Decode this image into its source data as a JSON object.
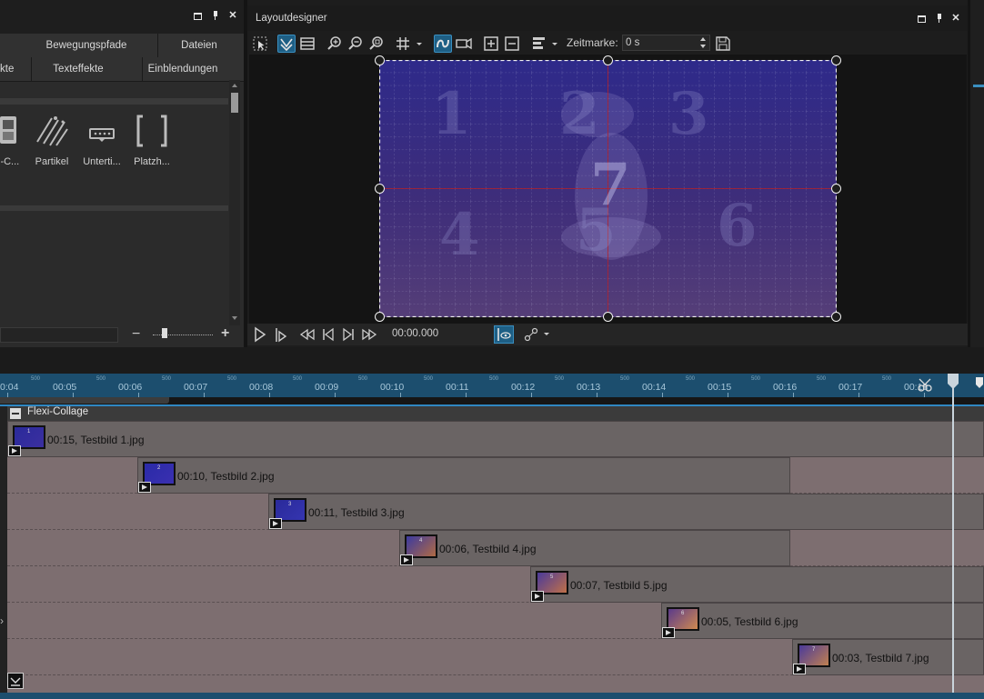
{
  "left_panel": {
    "tabs_row1": [
      "Bewegungspfade",
      "Dateien"
    ],
    "tabs_row2": [
      "kte",
      "Texteffekte",
      "Einblendungen"
    ],
    "items": [
      {
        "label": "i-C...",
        "icon": "collage-icon"
      },
      {
        "label": "Partikel",
        "icon": "particles-icon"
      },
      {
        "label": "Unterti...",
        "icon": "subtitle-icon"
      },
      {
        "label": "Platzh...",
        "icon": "placeholder-icon"
      }
    ],
    "zoom_minus": "−",
    "zoom_plus": "+"
  },
  "designer": {
    "title": "Layoutdesigner",
    "zeitmarke_label": "Zeitmarke:",
    "zeitmarke_value": "0 s",
    "playback_time": "00:00.000",
    "canvas_digits": [
      "1",
      "2",
      "3",
      "4",
      "5",
      "6",
      "7"
    ]
  },
  "timeline": {
    "ruler_labels": [
      "0:04",
      "00:05",
      "00:06",
      "00:07",
      "00:08",
      "00:09",
      "00:10",
      "00:11",
      "00:12",
      "00:13",
      "00:14",
      "00:15",
      "00:16",
      "00:17",
      "00:18"
    ],
    "sub_label": "500",
    "track_title": "Flexi-Collage",
    "clips": [
      {
        "label": "00:15, Testbild 1.jpg",
        "thumb": "1"
      },
      {
        "label": "00:10, Testbild 2.jpg",
        "thumb": "2"
      },
      {
        "label": "00:11, Testbild 3.jpg",
        "thumb": "3"
      },
      {
        "label": "00:06, Testbild 4.jpg",
        "thumb": "4"
      },
      {
        "label": "00:07, Testbild 5.jpg",
        "thumb": "5"
      },
      {
        "label": "00:05, Testbild 6.jpg",
        "thumb": "6"
      },
      {
        "label": "00:03, Testbild 7.jpg",
        "thumb": "7"
      }
    ]
  },
  "colors": {
    "accent": "#1e5f85",
    "ruler": "#1c4e6e",
    "track_bg": "#7d6e70",
    "clip_bg": "#6a6464"
  }
}
